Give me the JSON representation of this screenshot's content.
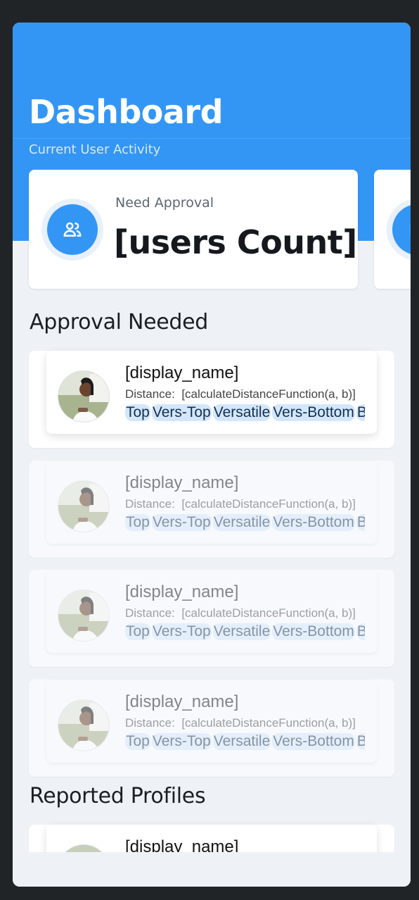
{
  "header": {
    "title": "Dashboard",
    "subtitle": "Current User Activity"
  },
  "stats": [
    {
      "label": "Need Approval",
      "value": "[users Count]",
      "icon": "users-icon"
    },
    {
      "label": "",
      "value": "",
      "icon": "card-icon"
    }
  ],
  "sections": {
    "approval_title": "Approval Needed",
    "reported_title": "Reported Profiles"
  },
  "approval_rows": [
    {
      "name": "[display_name]",
      "distance_label": "Distance:",
      "distance_value": "[calculateDistanceFunction(a, b)]",
      "tags": [
        "Top",
        "Vers-Top",
        "Versatile",
        "Vers-Bottom",
        "Bottom"
      ]
    },
    {
      "name": "[display_name]",
      "distance_label": "Distance:",
      "distance_value": "[calculateDistanceFunction(a, b)]",
      "tags": [
        "Top",
        "Vers-Top",
        "Versatile",
        "Vers-Bottom",
        "Bottom"
      ]
    },
    {
      "name": "[display_name]",
      "distance_label": "Distance:",
      "distance_value": "[calculateDistanceFunction(a, b)]",
      "tags": [
        "Top",
        "Vers-Top",
        "Versatile",
        "Vers-Bottom",
        "Bottom"
      ]
    },
    {
      "name": "[display_name]",
      "distance_label": "Distance:",
      "distance_value": "[calculateDistanceFunction(a, b)]",
      "tags": [
        "Top",
        "Vers-Top",
        "Versatile",
        "Vers-Bottom",
        "Bottom"
      ]
    }
  ],
  "reported_rows": [
    {
      "name": "[display_name]"
    }
  ],
  "colors": {
    "accent": "#3396f5",
    "tag_bg": "#d3e6fb",
    "background": "#eef2f7"
  }
}
